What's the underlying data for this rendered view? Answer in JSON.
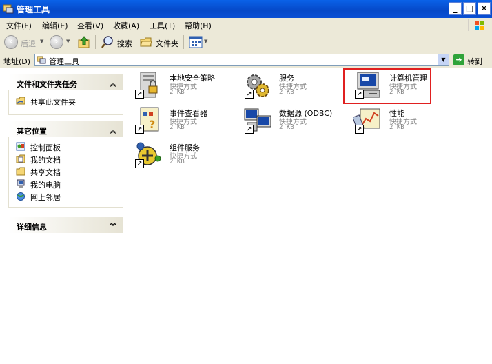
{
  "window": {
    "title": "管理工具"
  },
  "menu": [
    "文件(F)",
    "编辑(E)",
    "查看(V)",
    "收藏(A)",
    "工具(T)",
    "帮助(H)"
  ],
  "toolbar": {
    "back": "后退",
    "search": "搜索",
    "folders": "文件夹"
  },
  "address": {
    "label": "地址(D)",
    "value": "管理工具",
    "go": "转到"
  },
  "panels": {
    "tasks": {
      "title": "文件和文件夹任务",
      "items": [
        "共享此文件夹"
      ]
    },
    "places": {
      "title": "其它位置",
      "items": [
        "控制面板",
        "我的文档",
        "共享文档",
        "我的电脑",
        "网上邻居"
      ]
    },
    "details": {
      "title": "详细信息"
    }
  },
  "items": [
    {
      "name": "本地安全策略",
      "type": "快捷方式",
      "size": "2 KB",
      "icon": "local-security-policy-icon"
    },
    {
      "name": "服务",
      "type": "快捷方式",
      "size": "2 KB",
      "icon": "services-icon"
    },
    {
      "name": "计算机管理",
      "type": "快捷方式",
      "size": "2 KB",
      "icon": "computer-management-icon"
    },
    {
      "name": "事件查看器",
      "type": "快捷方式",
      "size": "2 KB",
      "icon": "event-viewer-icon"
    },
    {
      "name": "数据源 (ODBC)",
      "type": "快捷方式",
      "size": "2 KB",
      "icon": "odbc-icon"
    },
    {
      "name": "性能",
      "type": "快捷方式",
      "size": "2 KB",
      "icon": "performance-icon"
    },
    {
      "name": "组件服务",
      "type": "快捷方式",
      "size": "2 KB",
      "icon": "component-services-icon"
    }
  ],
  "colors": {
    "titlebar": "#0a50d8",
    "highlight": "#e02020",
    "panel": "#e6e3d4"
  }
}
